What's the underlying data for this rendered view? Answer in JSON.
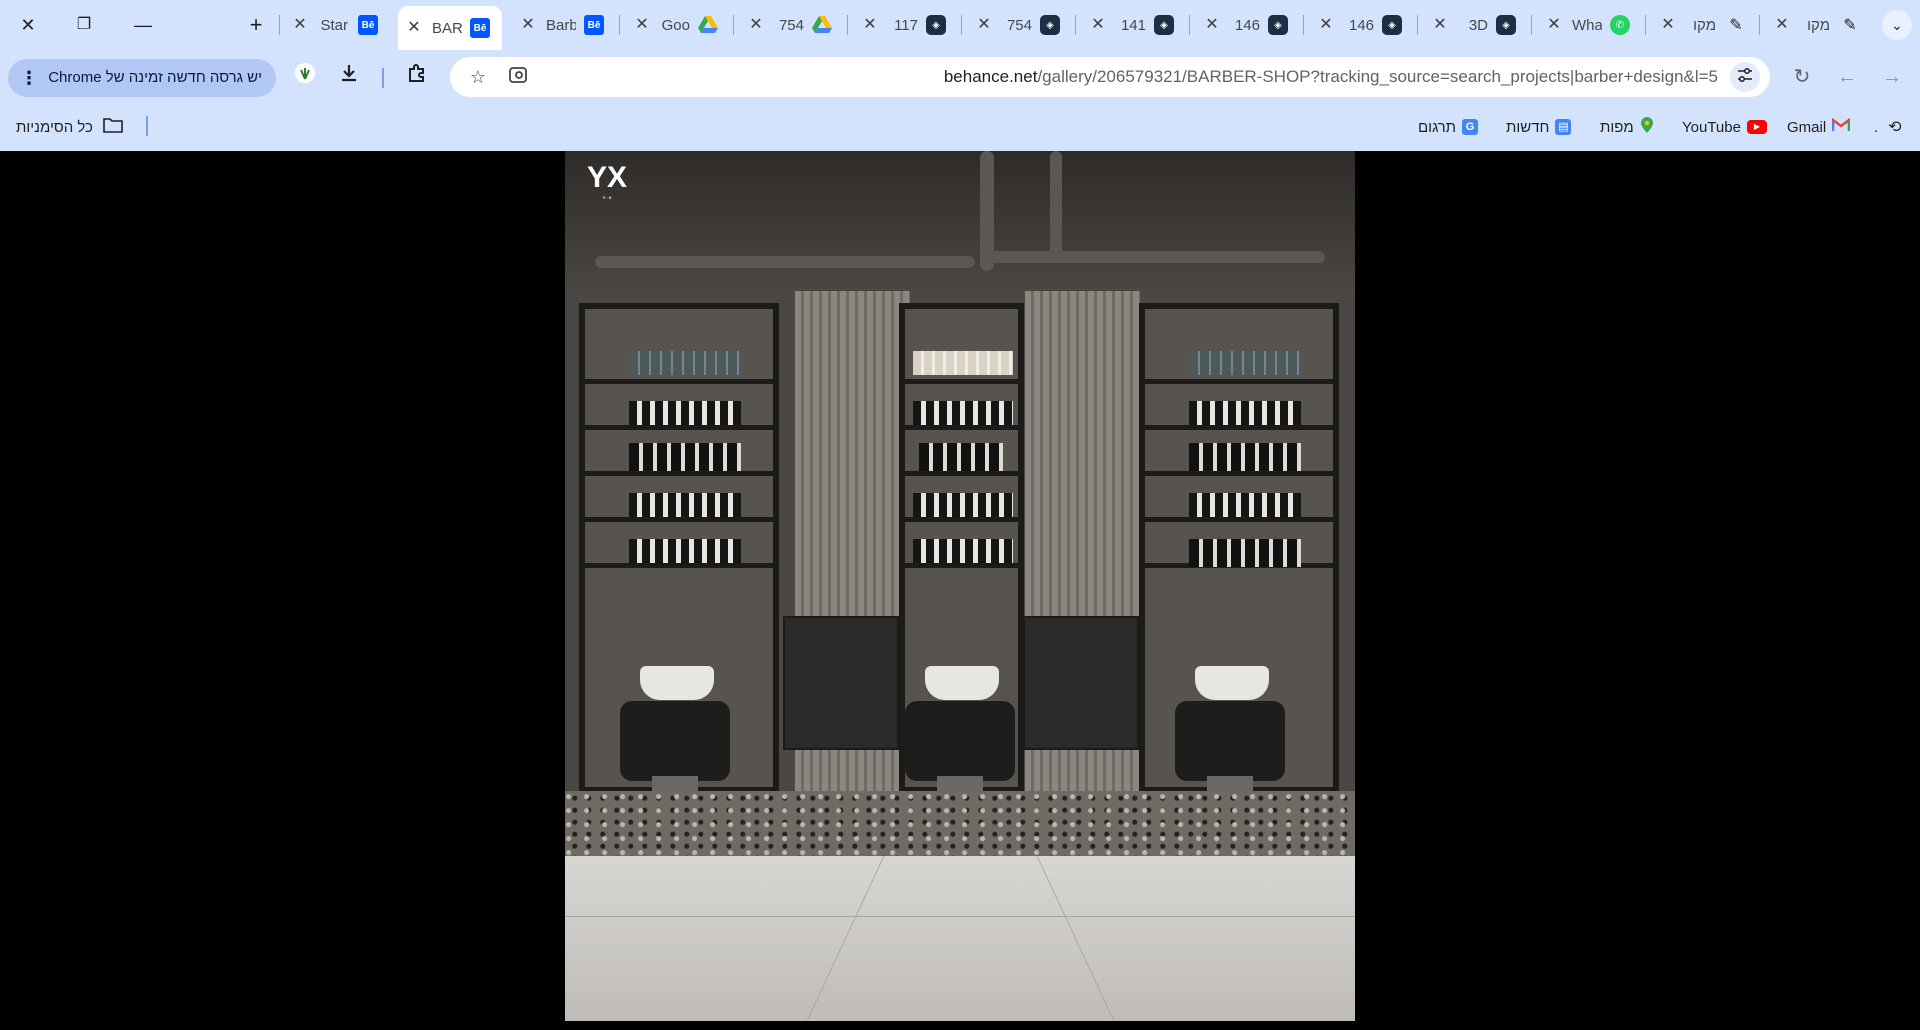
{
  "window": {
    "close_symbol": "✕",
    "restore_symbol": "❐",
    "minimize_symbol": "—",
    "new_tab_symbol": "+"
  },
  "tabs": [
    {
      "label": "Star",
      "icon": "behance-icon",
      "active": false
    },
    {
      "label": "BAR",
      "icon": "behance-icon",
      "active": true
    },
    {
      "label": "Barb",
      "icon": "behance-icon",
      "active": false
    },
    {
      "label": "Goo",
      "icon": "google-drive-icon",
      "active": false
    },
    {
      "label": "754",
      "icon": "google-drive-icon",
      "active": false
    },
    {
      "label": "117",
      "icon": "sketchup-icon",
      "active": false
    },
    {
      "label": "754",
      "icon": "sketchup-icon",
      "active": false
    },
    {
      "label": "141",
      "icon": "sketchup-icon",
      "active": false
    },
    {
      "label": "146",
      "icon": "sketchup-icon",
      "active": false
    },
    {
      "label": "146",
      "icon": "sketchup-icon",
      "active": false
    },
    {
      "label": "3D",
      "icon": "sketchup-icon",
      "active": false
    },
    {
      "label": "Wha",
      "icon": "whatsapp-icon",
      "active": false
    },
    {
      "label": "מקו",
      "icon": "pen-icon",
      "active": false
    },
    {
      "label": "מקו",
      "icon": "pen-icon",
      "active": false
    }
  ],
  "tab_close_symbol": "✕",
  "toolbar": {
    "update_text": "יש גרסה חדשה זמינה של Chrome",
    "url_host": "behance.net",
    "url_path": "/gallery/206579321/BARBER-SHOP?tracking_source=search_projects|barber+design&l=5"
  },
  "bookmarks": {
    "all_bookmarks": "כל הסימניות",
    "items": [
      {
        "label": ".",
        "icon": "history-icon"
      },
      {
        "label": "Gmail",
        "icon": "gmail-icon"
      },
      {
        "label": "YouTube",
        "icon": "youtube-icon"
      },
      {
        "label": "מפות",
        "icon": "maps-icon"
      },
      {
        "label": "חדשות",
        "icon": "news-icon"
      },
      {
        "label": "תרגום",
        "icon": "translate-icon"
      }
    ]
  },
  "colors": {
    "chrome_bg": "#d3e3fd",
    "behance": "#0057ff",
    "whatsapp": "#25d366",
    "youtube": "#ff0000"
  }
}
